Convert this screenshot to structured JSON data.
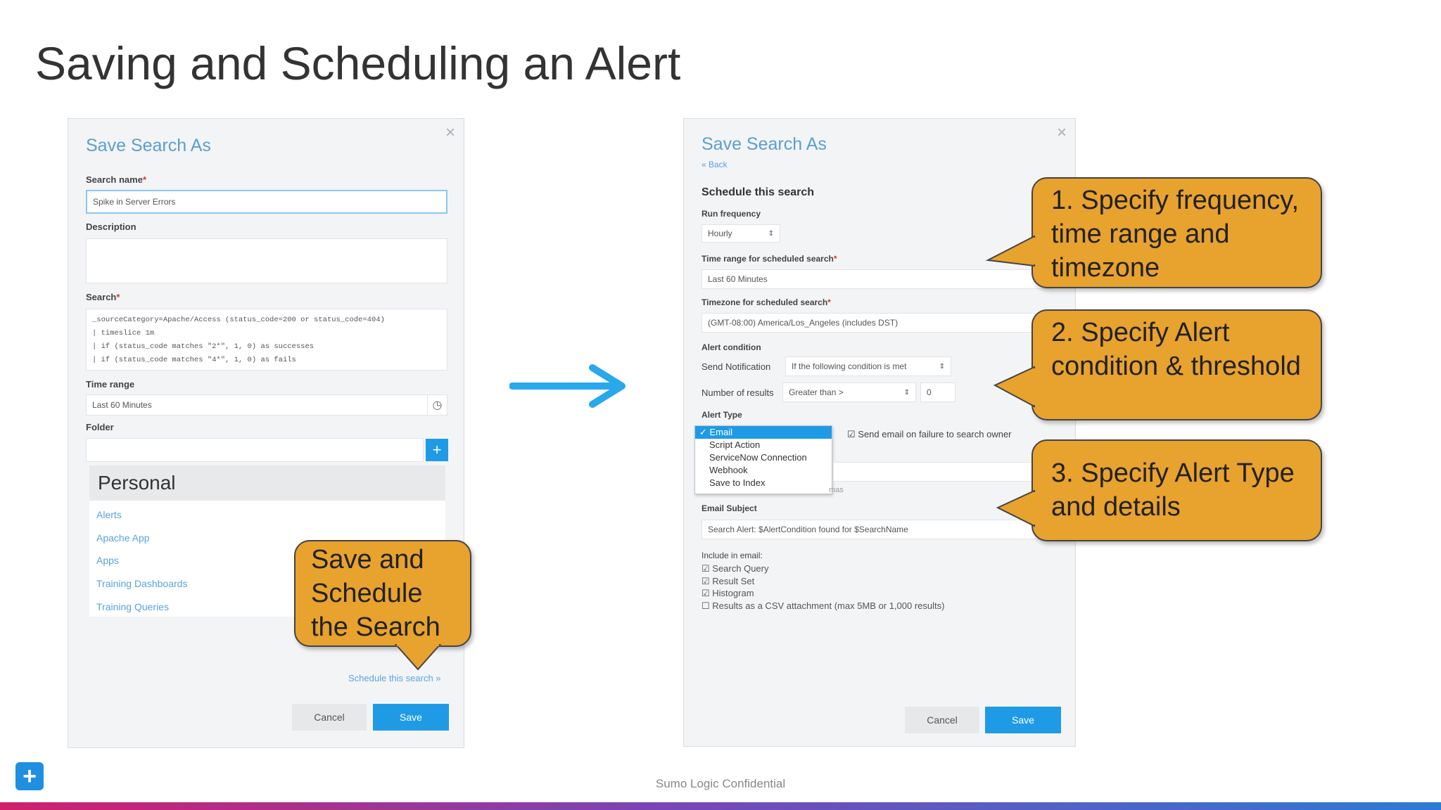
{
  "slide": {
    "title": "Saving and Scheduling an Alert",
    "footer": "Sumo Logic Confidential"
  },
  "dialog1": {
    "title": "Save Search As",
    "close": "×",
    "search_name_label": "Search name",
    "search_name_value": "Spike in Server Errors",
    "description_label": "Description",
    "search_label": "Search",
    "search_query": "_sourceCategory=Apache/Access (status_code=200 or status_code=404)\n| timeslice 1m\n| if (status_code matches \"2*\", 1, 0) as successes\n| if (status_code matches \"4*\", 1, 0) as fails",
    "time_range_label": "Time range",
    "time_range_value": "Last 60 Minutes",
    "folder_label": "Folder",
    "folder_add": "+",
    "folder_head": "Personal",
    "folders": [
      "Alerts",
      "Apache App",
      "Apps",
      "Training Dashboards",
      "Training Queries"
    ],
    "schedule_link": "Schedule this search »",
    "cancel": "Cancel",
    "save": "Save"
  },
  "dialog2": {
    "title": "Save Search As",
    "close": "×",
    "back": "« Back",
    "schedule_heading": "Schedule this search",
    "run_freq_label": "Run frequency",
    "run_freq_value": "Hourly",
    "time_range_label": "Time range for scheduled search",
    "time_range_value": "Last 60 Minutes",
    "timezone_label": "Timezone for scheduled search",
    "timezone_value": "(GMT-08:00) America/Los_Angeles (includes DST)",
    "alert_condition_label": "Alert condition",
    "send_notification_label": "Send Notification",
    "send_notification_value": "If the following condition is met",
    "num_results_label": "Number of results",
    "num_results_op": "Greater than >",
    "num_results_value": "0",
    "alert_type_label": "Alert Type",
    "alert_types": [
      "Email",
      "Script Action",
      "ServiceNow Connection",
      "Webhook",
      "Save to Index"
    ],
    "send_on_failure": "Send email on failure to search owner",
    "email_subject_label": "Email Subject",
    "email_subject_value": "Search Alert: $AlertCondition found for $SearchName",
    "include_label": "Include in email:",
    "include_items": [
      "Search Query",
      "Result Set",
      "Histogram",
      "Results as a CSV attachment (max 5MB or 1,000 results)"
    ],
    "partial_hint": "mas",
    "cancel": "Cancel",
    "save": "Save"
  },
  "callouts": {
    "c0": "Save and Schedule the Search",
    "c1": "1. Specify frequency, time range and timezone",
    "c2": "2. Specify Alert condition & threshold",
    "c3": "3. Specify Alert Type and details"
  },
  "colors": {
    "accent": "#1f9be6",
    "callout": "#e8a22e",
    "arrow": "#29a8ec"
  }
}
